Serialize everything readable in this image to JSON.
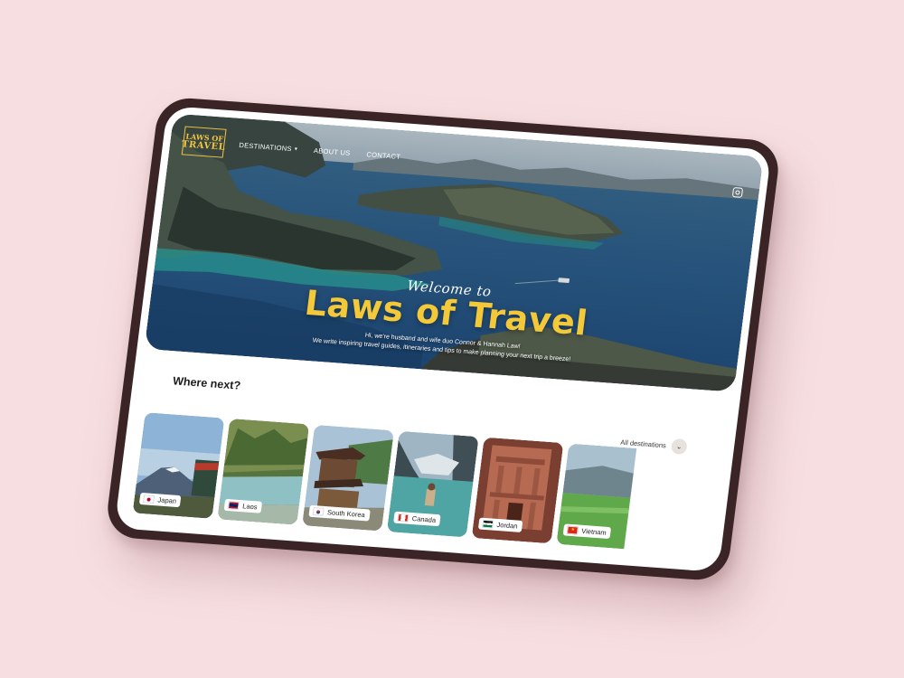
{
  "nav": {
    "logo_line1": "LAWS OF",
    "logo_line2": "TRAVEL",
    "links": [
      "DESTINATIONS",
      "ABOUT US",
      "CONTACT"
    ]
  },
  "hero": {
    "welcome": "Welcome to",
    "title": "Laws of Travel",
    "intro_line1": "Hi, we're husband and wife duo Connor & Hannah Law!",
    "intro_line2": "We write inspiring travel guides, itineraries and tips to make planning your next trip a breeze!"
  },
  "section": {
    "title": "Where next?",
    "filter_label": "All destinations"
  },
  "destinations": [
    {
      "name": "Japan"
    },
    {
      "name": "Laos"
    },
    {
      "name": "South Korea"
    },
    {
      "name": "Canada"
    },
    {
      "name": "Jordan"
    },
    {
      "name": "Vietnam"
    }
  ],
  "colors": {
    "accent_yellow": "#f3c93a",
    "background_pink": "#f7dfe1",
    "device_frame": "#3a2426"
  },
  "icons": [
    "chevron-down-icon",
    "instagram-icon",
    "flag-icon"
  ]
}
